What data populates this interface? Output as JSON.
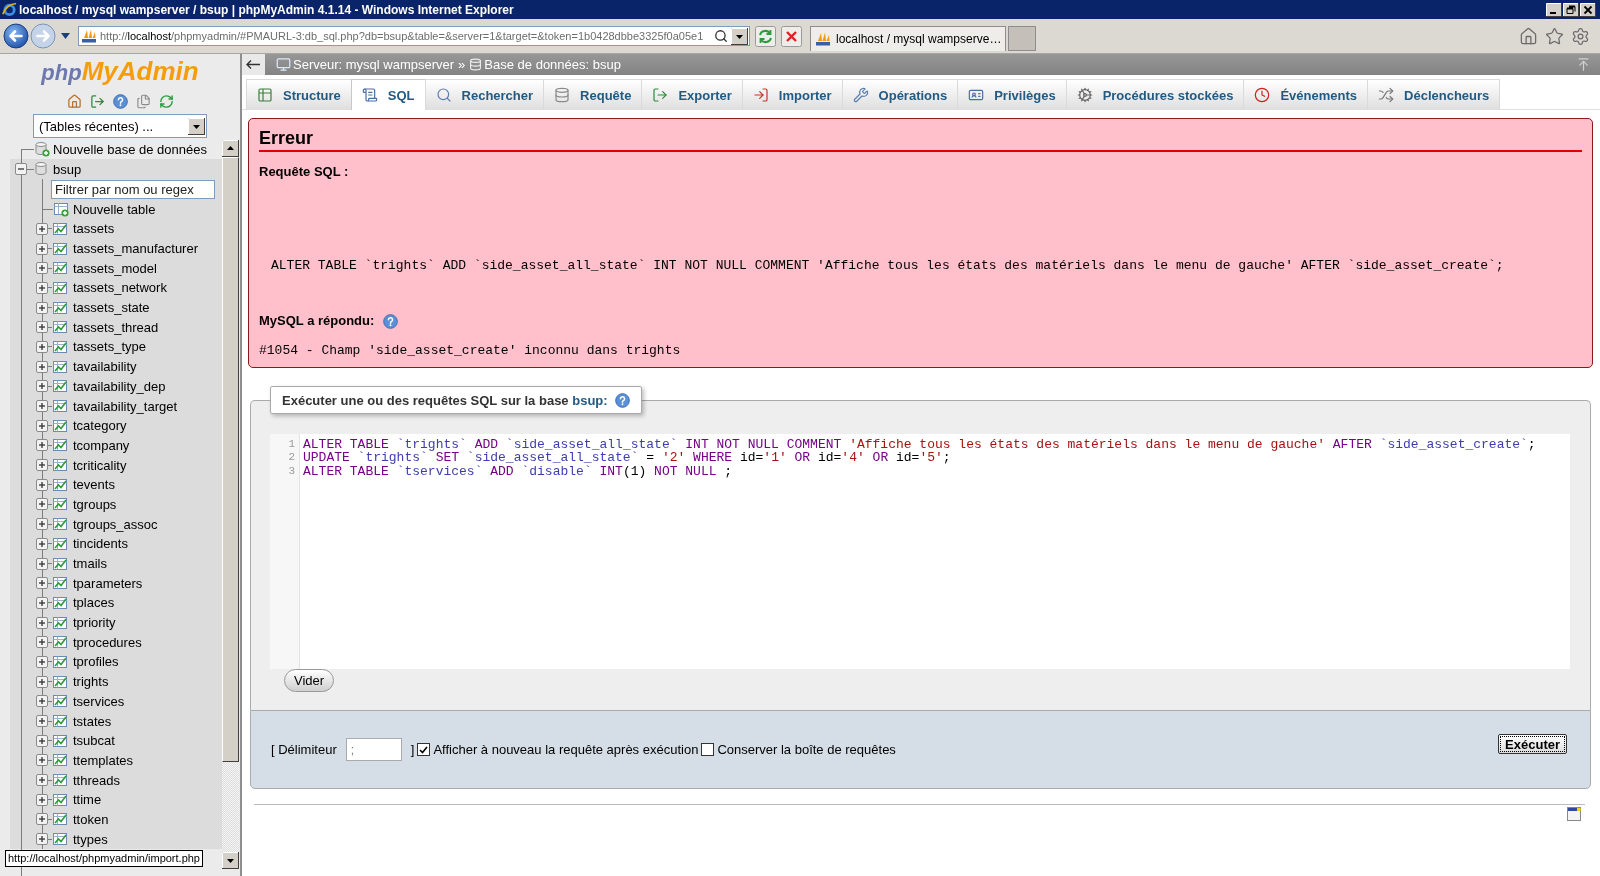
{
  "window": {
    "title": "localhost / mysql wampserver / bsup | phpMyAdmin 4.1.14 - Windows Internet Explorer"
  },
  "browser": {
    "address": {
      "scheme": "http://",
      "host": "localhost",
      "path": "/phpmyadmin/#PMAURL-3:db_sql.php?db=bsup&table=&server=1&target=&token=1b0428dbbe3325f0a05e1"
    },
    "tabs": [
      {
        "label": "localhost / mysql wampserve…",
        "selected": true
      }
    ]
  },
  "sidebar": {
    "logo": {
      "part_1": "php",
      "part_2": "MyAdmin"
    },
    "recent_tables": {
      "value": "(Tables récentes) ..."
    },
    "new_database": "Nouvelle base de données",
    "databases": [
      {
        "name": "bsup",
        "selected": true,
        "expanded": true,
        "filter": {
          "placeholder": "Filtrer par nom ou regex"
        },
        "new_table": "Nouvelle table",
        "tables": [
          {
            "name": "tassets",
            "expanded": false
          },
          {
            "name": "tassets_manufacturer",
            "expanded": false
          },
          {
            "name": "tassets_model",
            "expanded": false
          },
          {
            "name": "tassets_network",
            "expanded": false
          },
          {
            "name": "tassets_state",
            "expanded": false
          },
          {
            "name": "tassets_thread",
            "expanded": false
          },
          {
            "name": "tassets_type",
            "expanded": false
          },
          {
            "name": "tavailability",
            "expanded": false
          },
          {
            "name": "tavailability_dep",
            "expanded": false
          },
          {
            "name": "tavailability_target",
            "expanded": false
          },
          {
            "name": "tcategory",
            "expanded": false
          },
          {
            "name": "tcompany",
            "expanded": false
          },
          {
            "name": "tcriticality",
            "expanded": false
          },
          {
            "name": "tevents",
            "expanded": false
          },
          {
            "name": "tgroups",
            "expanded": false
          },
          {
            "name": "tgroups_assoc",
            "expanded": false
          },
          {
            "name": "tincidents",
            "expanded": false
          },
          {
            "name": "tmails",
            "expanded": false
          },
          {
            "name": "tparameters",
            "expanded": false
          },
          {
            "name": "tplaces",
            "expanded": false
          },
          {
            "name": "tpriority",
            "expanded": false
          },
          {
            "name": "tprocedures",
            "expanded": false
          },
          {
            "name": "tprofiles",
            "expanded": false
          },
          {
            "name": "trights",
            "expanded": false
          },
          {
            "name": "tservices",
            "expanded": false
          },
          {
            "name": "tstates",
            "expanded": false
          },
          {
            "name": "tsubcat",
            "expanded": false
          },
          {
            "name": "ttemplates",
            "expanded": false
          },
          {
            "name": "tthreads",
            "expanded": false
          },
          {
            "name": "ttime",
            "expanded": false
          },
          {
            "name": "ttoken",
            "expanded": false
          },
          {
            "name": "ttypes",
            "expanded": false
          }
        ]
      }
    ]
  },
  "breadcrumb": {
    "server": "Serveur: mysql wampserver",
    "separator": "»",
    "database": "Base de données: bsup"
  },
  "tabs": [
    {
      "label": "Structure",
      "kind": "structure",
      "selected": false
    },
    {
      "label": "SQL",
      "kind": "sql",
      "selected": true
    },
    {
      "label": "Rechercher",
      "kind": "search",
      "selected": false
    },
    {
      "label": "Requête",
      "kind": "query",
      "selected": false
    },
    {
      "label": "Exporter",
      "kind": "export",
      "selected": false
    },
    {
      "label": "Importer",
      "kind": "import",
      "selected": false
    },
    {
      "label": "Opérations",
      "kind": "operations",
      "selected": false
    },
    {
      "label": "Privilèges",
      "kind": "privileges",
      "selected": false
    },
    {
      "label": "Procédures stockées",
      "kind": "procedures",
      "selected": false
    },
    {
      "label": "Événements",
      "kind": "events",
      "selected": false
    },
    {
      "label": "Déclencheurs",
      "kind": "triggers",
      "selected": false
    }
  ],
  "error": {
    "title": "Erreur",
    "query_label": "Requête SQL :",
    "query": "ALTER TABLE `trights` ADD `side_asset_all_state` INT NOT NULL COMMENT 'Affiche tous les états des matériels dans le menu de gauche' AFTER `side_asset_create`;",
    "response_label": "MySQL a répondu:",
    "message": "#1054 - Champ 'side_asset_create' inconnu dans trights"
  },
  "sql_form": {
    "legend": "Exécuter une ou des requêtes SQL sur la base",
    "database_link": "bsup:",
    "lines": [
      {
        "number": "1",
        "tokens": [
          {
            "kind": "keyword",
            "text": "ALTER TABLE "
          },
          {
            "kind": "identifier",
            "text": "`trights` "
          },
          {
            "kind": "keyword",
            "text": "ADD "
          },
          {
            "kind": "identifier",
            "text": "`side_asset_all_state` "
          },
          {
            "kind": "keyword",
            "text": "INT NOT NULL COMMENT "
          },
          {
            "kind": "string",
            "text": "'Affiche tous les états des matériels dans le menu de gauche' "
          },
          {
            "kind": "keyword",
            "text": "AFTER "
          },
          {
            "kind": "identifier",
            "text": "`side_asset_create`"
          },
          {
            "kind": "plain",
            "text": ";"
          }
        ]
      },
      {
        "number": "2",
        "tokens": [
          {
            "kind": "keyword",
            "text": "UPDATE "
          },
          {
            "kind": "identifier",
            "text": "`trights` "
          },
          {
            "kind": "keyword",
            "text": "SET "
          },
          {
            "kind": "identifier",
            "text": "`side_asset_all_state` "
          },
          {
            "kind": "plain",
            "text": "= "
          },
          {
            "kind": "string",
            "text": "'2' "
          },
          {
            "kind": "keyword",
            "text": "WHERE "
          },
          {
            "kind": "plain",
            "text": "id="
          },
          {
            "kind": "string",
            "text": "'1' "
          },
          {
            "kind": "keyword",
            "text": "OR "
          },
          {
            "kind": "plain",
            "text": "id="
          },
          {
            "kind": "string",
            "text": "'4' "
          },
          {
            "kind": "keyword",
            "text": "OR "
          },
          {
            "kind": "plain",
            "text": "id="
          },
          {
            "kind": "string",
            "text": "'5'"
          },
          {
            "kind": "plain",
            "text": ";"
          }
        ]
      },
      {
        "number": "3",
        "tokens": [
          {
            "kind": "keyword",
            "text": "ALTER TABLE "
          },
          {
            "kind": "identifier",
            "text": "`tservices` "
          },
          {
            "kind": "keyword",
            "text": "ADD "
          },
          {
            "kind": "identifier",
            "text": "`disable` "
          },
          {
            "kind": "keyword",
            "text": "INT"
          },
          {
            "kind": "plain",
            "text": "(1) "
          },
          {
            "kind": "keyword",
            "text": "NOT NULL "
          },
          {
            "kind": "plain",
            "text": ";"
          }
        ]
      }
    ],
    "clear_button": "Vider",
    "delimiter": {
      "label": "[ Délimiteur",
      "value": ";",
      "closing": "]"
    },
    "options": [
      {
        "label": "Afficher à nouveau la requête après exécution",
        "checked": true
      },
      {
        "label": "Conserver la boîte de requêtes",
        "checked": false
      }
    ],
    "submit_button": "Exécuter"
  },
  "status_bar": {
    "text": "http://localhost/phpmyadmin/import.php"
  }
}
